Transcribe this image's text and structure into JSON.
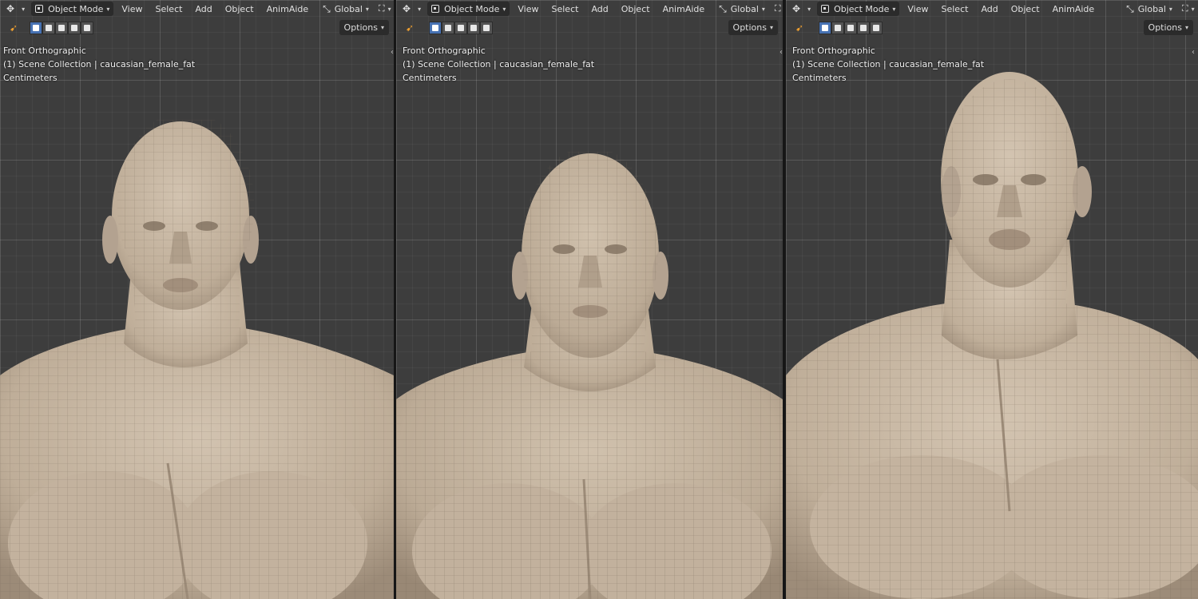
{
  "colors": {
    "viewport_bg": "#3d3d3d",
    "grid_line": "#4a4a4a",
    "skin": "#c8b8a4",
    "skin_shadow": "#9a8a78",
    "active_select_mode": "#4772b3",
    "tool_accent": "#f0a030"
  },
  "viewports": [
    {
      "mode_label": "Object Mode",
      "menu": [
        "View",
        "Select",
        "Add",
        "Object",
        "AnimAide"
      ],
      "transform_orientation": "Global",
      "options_label": "Options",
      "view_name": "Front Orthographic",
      "collection_line": "(1) Scene Collection | caucasian_female_fat",
      "units": "Centimeters",
      "icons": [
        "gizmo-icon",
        "object-mode-icon",
        "transform-orientation-icon",
        "snap-icon",
        "select-tool-icon"
      ]
    },
    {
      "mode_label": "Object Mode",
      "menu": [
        "View",
        "Select",
        "Add",
        "Object",
        "AnimAide"
      ],
      "transform_orientation": "Global",
      "options_label": "Options",
      "view_name": "Front Orthographic",
      "collection_line": "(1) Scene Collection | caucasian_female_fat",
      "units": "Centimeters",
      "icons": [
        "gizmo-icon",
        "object-mode-icon",
        "transform-orientation-icon",
        "snap-icon",
        "select-tool-icon"
      ]
    },
    {
      "mode_label": "Object Mode",
      "menu": [
        "View",
        "Select",
        "Add",
        "Object",
        "AnimAide"
      ],
      "transform_orientation": "Global",
      "options_label": "Options",
      "view_name": "Front Orthographic",
      "collection_line": "(1) Scene Collection | caucasian_female_fat",
      "units": "Centimeters",
      "icons": [
        "gizmo-icon",
        "object-mode-icon",
        "transform-orientation-icon",
        "snap-icon",
        "select-tool-icon"
      ]
    }
  ]
}
